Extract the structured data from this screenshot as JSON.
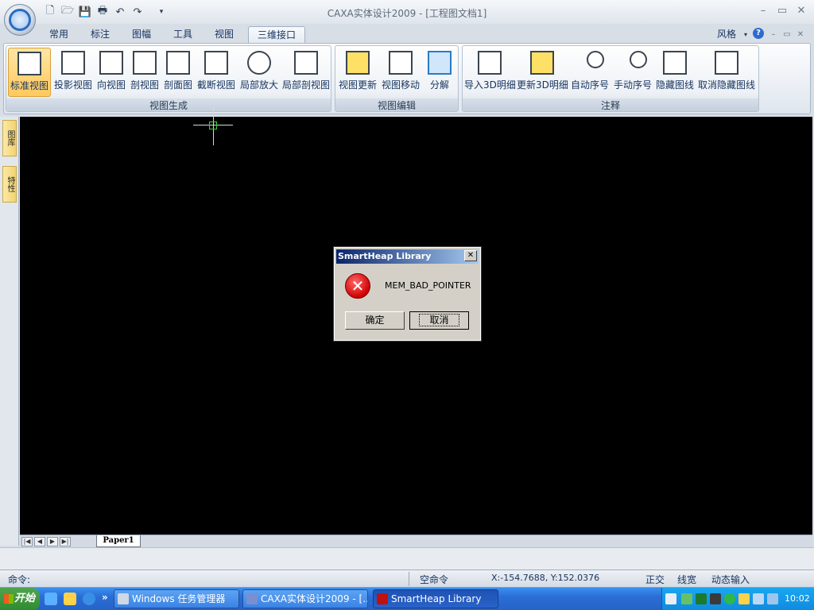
{
  "window": {
    "title": "CAXA实体设计2009 - [工程图文档1]",
    "controls": {
      "minimize": "–",
      "restore": "▭",
      "close": "✕"
    },
    "inner_controls": {
      "minimize": "–",
      "restore": "▭",
      "close": "✕"
    }
  },
  "quick_access": {
    "items": [
      "new-icon",
      "open-icon",
      "save-icon",
      "print-icon",
      "undo-icon",
      "redo-icon",
      "customize-icon"
    ]
  },
  "menu_tabs": [
    "常用",
    "标注",
    "图幅",
    "工具",
    "视图",
    "三维接口"
  ],
  "active_tab": "三维接口",
  "style_menu": "风格",
  "help": "?",
  "ribbon": {
    "groups": [
      {
        "label": "视图生成",
        "buttons": [
          "标准视图",
          "投影视图",
          "向视图",
          "剖视图",
          "剖面图",
          "截断视图",
          "局部放大",
          "局部剖视图"
        ]
      },
      {
        "label": "视图编辑",
        "buttons": [
          "视图更新",
          "视图移动",
          "分解"
        ]
      },
      {
        "label": "注释",
        "buttons": [
          "导入3D明细",
          "更新3D明细",
          "自动序号",
          "手动序号",
          "隐藏图线",
          "取消隐藏图线"
        ]
      }
    ],
    "active_button": "标准视图"
  },
  "side_tabs": [
    "图库",
    "特性"
  ],
  "sheet_tabs": [
    "Paper1"
  ],
  "command": {
    "label": "命令:"
  },
  "status": {
    "state": "空命令",
    "coords": "X:-154.7688, Y:152.0376",
    "toggles": [
      "正交",
      "线宽",
      "动态输入"
    ]
  },
  "dialog": {
    "title": "SmartHeap Library",
    "close": "✕",
    "icon": "error-icon",
    "message": "MEM_BAD_POINTER",
    "ok": "确定",
    "cancel": "取消"
  },
  "taskbar": {
    "start": "开始",
    "more": "»",
    "tasks": [
      "Windows 任务管理器",
      "CAXA实体设计2009 - [...",
      "SmartHeap Library"
    ],
    "active_task": "SmartHeap Library",
    "clock": "10:02"
  },
  "colors": {
    "canvas": "#000000",
    "accent": "#ffc95c",
    "error": "#d00000",
    "crosshair_box": "#3ad13a"
  }
}
